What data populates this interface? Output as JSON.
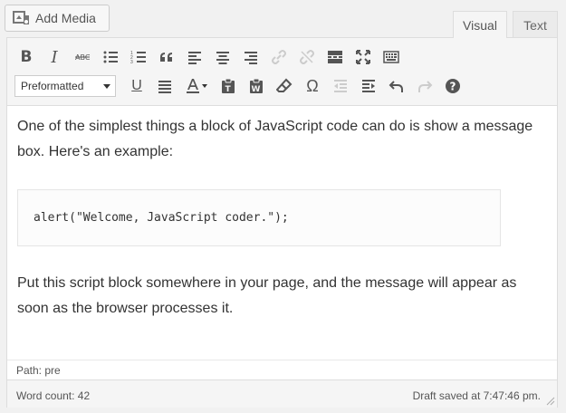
{
  "media": {
    "add_label": "Add Media",
    "icon": "media-icon"
  },
  "tabs": {
    "visual": "Visual",
    "text": "Text"
  },
  "toolbar": {
    "row1": [
      "bold",
      "italic",
      "strikethrough",
      "bulleted-list",
      "numbered-list",
      "blockquote",
      "align-left",
      "align-center",
      "align-right",
      "insert-link",
      "remove-link",
      "read-more",
      "fullscreen",
      "toolbar-toggle"
    ],
    "format_value": "Preformatted",
    "row2": [
      "underline",
      "justify",
      "text-color",
      "paste-as-text",
      "paste-from-word",
      "clear-formatting",
      "special-character",
      "outdent",
      "indent",
      "undo",
      "redo",
      "help"
    ],
    "labels": {
      "bold": "B",
      "italic": "I",
      "underline": "U",
      "omega": "Ω",
      "help": "?"
    }
  },
  "content": {
    "p1": "One of the simplest things a block of JavaScript code can do is show a message box. Here's an example:",
    "code": "alert(\"Welcome, JavaScript coder.\");",
    "p2": "Put this script block somewhere in your page, and the message will appear as soon as the browser processes it."
  },
  "status": {
    "path": "Path: pre",
    "word_count": "Word count: 42",
    "draft_saved": "Draft saved at 7:47:46 pm."
  },
  "colors": {
    "background": "#f1f1f1",
    "toolbar": "#f5f5f5",
    "border": "#dddddd",
    "icon": "#555555",
    "disabled_icon": "#cccccc"
  }
}
